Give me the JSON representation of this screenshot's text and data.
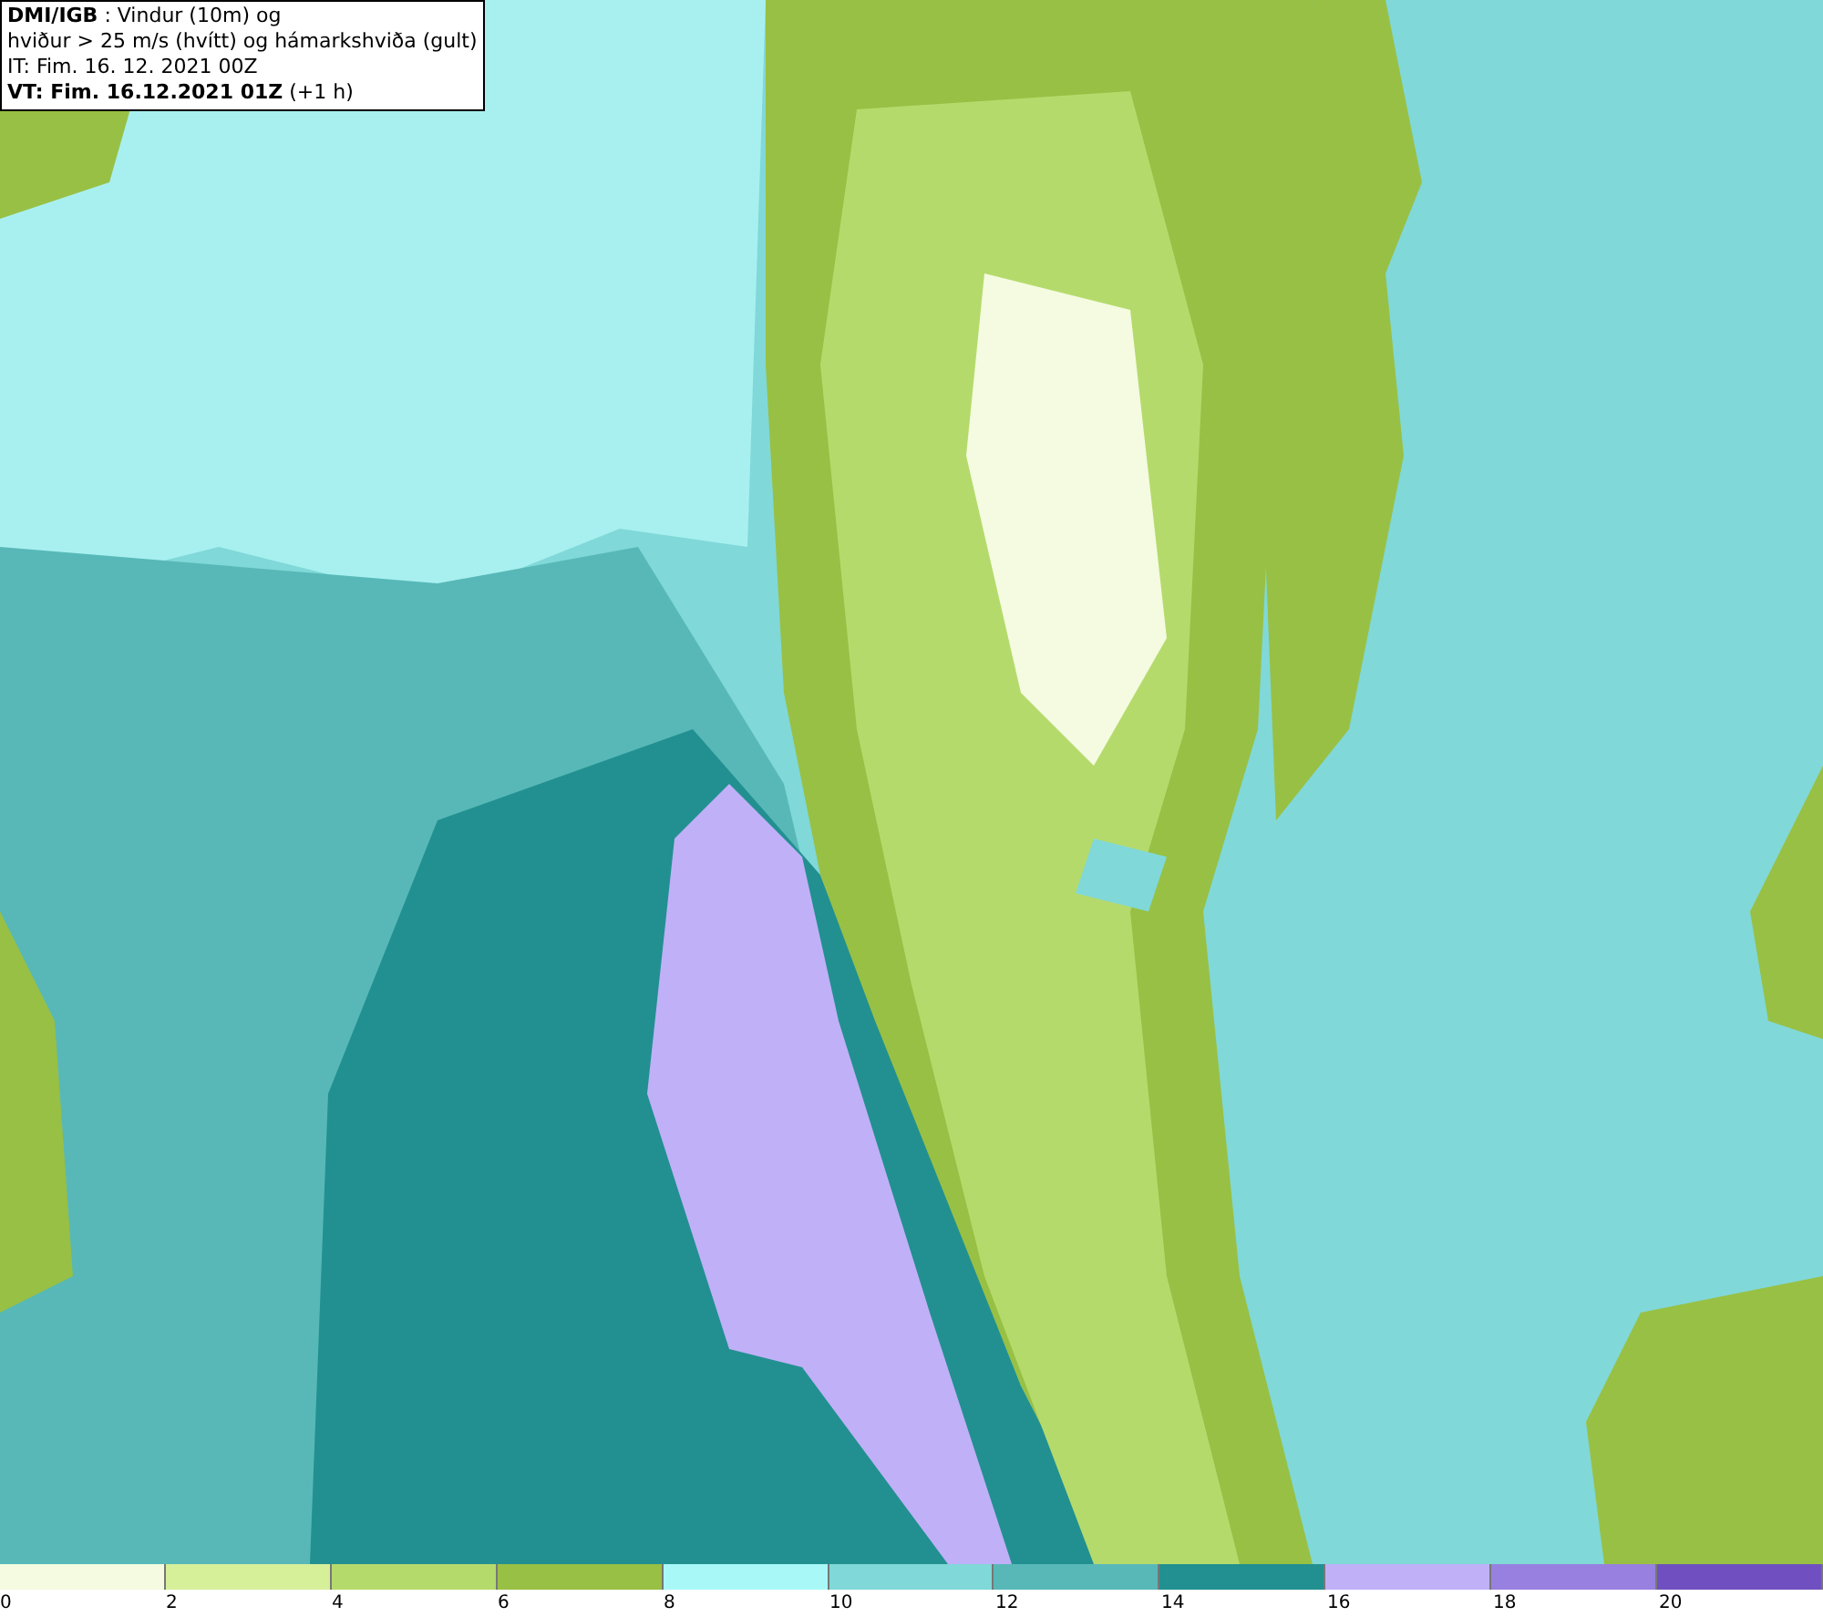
{
  "title_box": {
    "lines": [
      "**DMI/IGB** : Vindur (10m) og",
      "hviður > 25 m/s (hvítt) og hámarkshviða (gult)",
      "IT: Fim. 16. 12. 2021 00Z",
      "**VT: Fim. 16.12.2021 01Z** (+1 h)"
    ]
  },
  "legend": {
    "bins": [
      {
        "color": "#f4fbe0"
      },
      {
        "color": "#d6f09a"
      },
      {
        "color": "#b5da6c"
      },
      {
        "color": "#98c044"
      },
      {
        "color": "#a8f8f8"
      },
      {
        "color": "#80d8d8"
      },
      {
        "color": "#58b8b8"
      },
      {
        "color": "#229090"
      },
      {
        "color": "#c0b0f8"
      },
      {
        "color": "#9880e0"
      },
      {
        "color": "#7050c0"
      }
    ],
    "labels": [
      "0",
      "2",
      "4",
      "6",
      "8",
      "10",
      "12",
      "14",
      "16",
      "18",
      "20"
    ]
  }
}
